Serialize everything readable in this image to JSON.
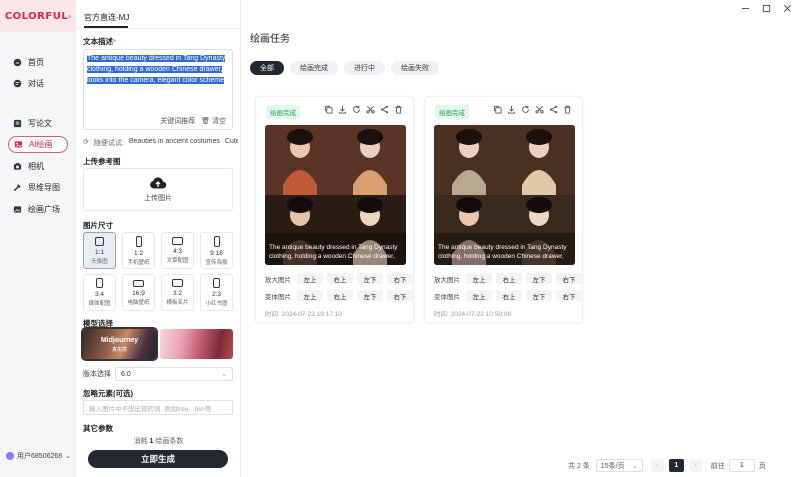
{
  "app": {
    "brand": "COLORFUL",
    "brand_mark": "®",
    "brand_color": "#e0204d",
    "user_name": "用户68506268"
  },
  "sidebar": {
    "items": [
      {
        "label": "首页",
        "icon": "home-icon",
        "active": false
      },
      {
        "label": "对话",
        "icon": "chat-icon",
        "active": false
      },
      {
        "label": "写论文",
        "icon": "paper-icon",
        "active": false
      },
      {
        "label": "AI绘画",
        "icon": "paint-icon",
        "active": true
      },
      {
        "label": "相机",
        "icon": "camera-icon",
        "active": false
      },
      {
        "label": "思维导图",
        "icon": "mindmap-icon",
        "active": false
      },
      {
        "label": "绘画广场",
        "icon": "gallery-icon",
        "active": false
      }
    ]
  },
  "panel": {
    "tab": "官方直连-MJ",
    "prompt_title": "文本描述",
    "prompt_required": "*",
    "prompt_text": "The antique beauty dressed in Tang Dynasty clothing, holding a wooden Chinese drawer, looks into the camera, elegant color scheme",
    "keyword_btn": "关键词推荐",
    "clear_btn": "清空",
    "random_label": "随便试试:",
    "random_samples": [
      "Beauties in ancient costumes",
      "Cute"
    ],
    "upload_title": "上传参考图",
    "upload_label": "上传图片",
    "size_title": "图片尺寸",
    "sizes": [
      {
        "ratio": "1:1",
        "desc": "头像图",
        "selected": true
      },
      {
        "ratio": "1:2",
        "desc": "手机壁纸",
        "selected": false
      },
      {
        "ratio": "4:3",
        "desc": "文章配图",
        "selected": false
      },
      {
        "ratio": "9:16",
        "desc": "宣传海报",
        "selected": false
      },
      {
        "ratio": "3:4",
        "desc": "媒体配图",
        "selected": false
      },
      {
        "ratio": "16:9",
        "desc": "电脑壁纸",
        "selected": false
      },
      {
        "ratio": "3:2",
        "desc": "横板名片",
        "selected": false
      },
      {
        "ratio": "2:3",
        "desc": "小红书图",
        "selected": false
      }
    ],
    "model_title": "模型选择",
    "models": [
      {
        "name": "Midjourney",
        "sub": "真实感",
        "selected": true
      },
      {
        "name": "",
        "sub": "",
        "selected": false
      }
    ],
    "version_label": "版本选择",
    "version_value": "6.0",
    "neg_title": "忽略元素(可选)",
    "neg_placeholder": "输入图片中不想出现的词, 例如tree、fish等",
    "other_title": "其它参数",
    "cost_prefix": "消耗",
    "cost_value": "1",
    "cost_suffix": "绘画条数",
    "generate_btn": "立即生成"
  },
  "main": {
    "title": "绘画任务",
    "filters": [
      {
        "label": "全部",
        "active": true
      },
      {
        "label": "绘画完成",
        "active": false
      },
      {
        "label": "进行中",
        "active": false
      },
      {
        "label": "绘画失败",
        "active": false
      }
    ],
    "cards": [
      {
        "status": "绘画完成",
        "caption": "The antique beauty dressed in Tang Dynasty clothing, holding a wooden Chinese drawer,",
        "upscale_label": "放大图片",
        "variation_label": "变体图片",
        "buttons": [
          "左上",
          "右上",
          "左下",
          "右下"
        ],
        "time_label": "时间:",
        "time": "2024-07-23 19:17:10"
      },
      {
        "status": "绘画完成",
        "caption": "The antique beauty dressed in Tang Dynasty clothing, holding a wooden Chinese drawer,",
        "upscale_label": "放大图片",
        "variation_label": "变体图片",
        "buttons": [
          "左上",
          "右上",
          "左下",
          "右下"
        ],
        "time_label": "时间:",
        "time": "2024-07-22 10:50:08"
      }
    ]
  },
  "pagination": {
    "total": "共 2 条",
    "page_size": "15条/页",
    "current": "1",
    "goto_label": "前往",
    "goto_value": "1",
    "page_suffix": "页"
  }
}
